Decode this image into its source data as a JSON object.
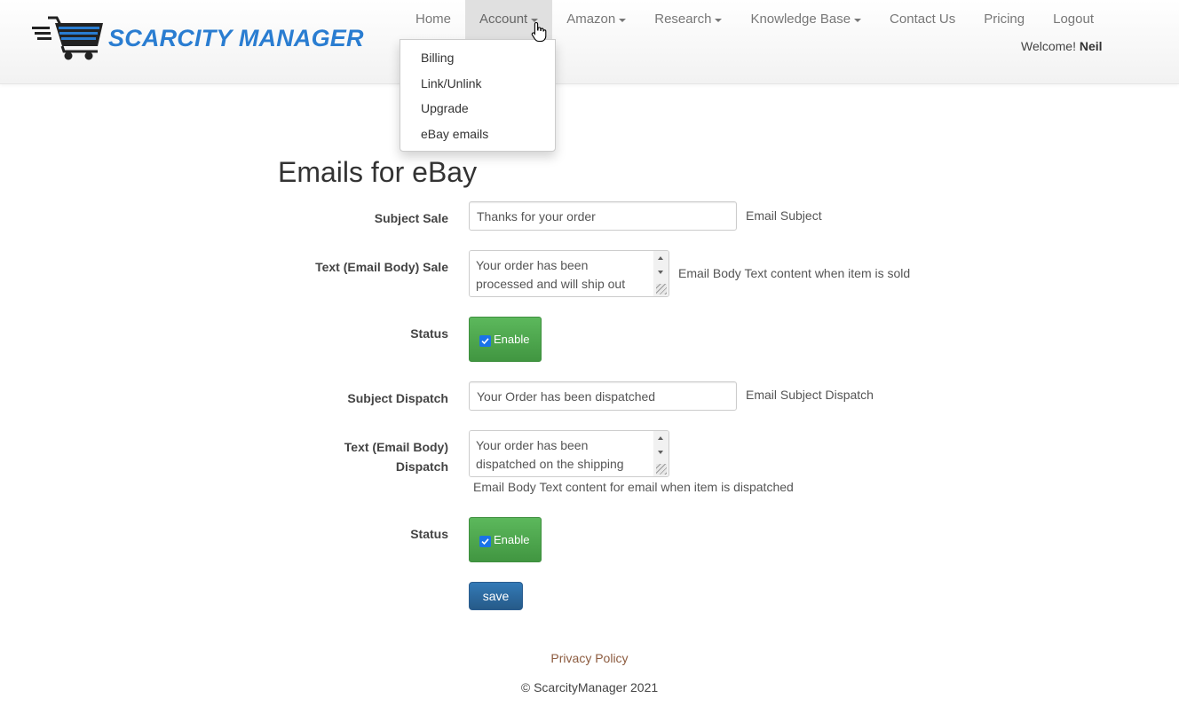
{
  "brand": {
    "name": "SCARCITY MANAGER",
    "logo_icon": "shopping-cart-icon",
    "brand_color": "#2a7dd1"
  },
  "nav": {
    "items": [
      {
        "label": "Home",
        "dropdown": false
      },
      {
        "label": "Account",
        "dropdown": true,
        "active": true
      },
      {
        "label": "Amazon",
        "dropdown": true
      },
      {
        "label": "Research",
        "dropdown": true
      },
      {
        "label": "Knowledge Base",
        "dropdown": true
      },
      {
        "label": "Contact Us",
        "dropdown": false
      },
      {
        "label": "Pricing",
        "dropdown": false
      },
      {
        "label": "Logout",
        "dropdown": false
      }
    ],
    "welcome_prefix": "Welcome!",
    "welcome_user": "Neil"
  },
  "account_menu": {
    "items": [
      "Billing",
      "Link/Unlink",
      "Upgrade",
      "eBay emails"
    ]
  },
  "page": {
    "title": "Emails for eBay",
    "subject_sale": {
      "label": "Subject Sale",
      "value": "Thanks for your order",
      "help": "Email Subject"
    },
    "body_sale": {
      "label": "Text (Email Body) Sale",
      "value": "Your order has been processed and will ship out",
      "help": "Email Body Text content when item is sold"
    },
    "status_sale": {
      "label": "Status",
      "toggle_label": "Enable",
      "checked": true
    },
    "subject_dispatch": {
      "label": "Subject Dispatch",
      "value": "Your Order has been dispatched",
      "help": "Email Subject Dispatch"
    },
    "body_dispatch": {
      "label_line1": "Text (Email Body)",
      "label_line2": "Dispatch",
      "value": "Your order has been dispatched on the shipping",
      "help": "Email Body Text content for email when item is dispatched"
    },
    "status_dispatch": {
      "label": "Status",
      "toggle_label": "Enable",
      "checked": true
    },
    "save_label": "save"
  },
  "footer": {
    "privacy_link": "Privacy Policy",
    "copyright": "© ScarcityManager 2021"
  },
  "colors": {
    "toggle_green": "#5cb85c",
    "save_blue": "#337ab7",
    "footer_link": "#8c5b3f"
  }
}
